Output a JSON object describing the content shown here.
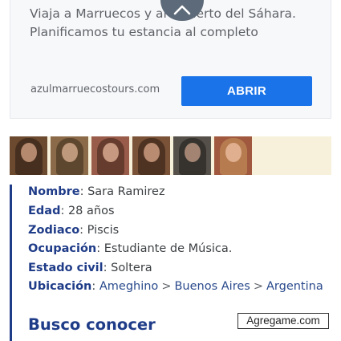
{
  "ad": {
    "line1": "Viaja a Marruecos y al desierto del Sáhara.",
    "line2": "Planificamos tu estancia al completo",
    "url": "azulmarruecostours.com",
    "button": "ABRIR"
  },
  "photos": [
    {
      "name": "photo-1",
      "color": "#6b4a2f"
    },
    {
      "name": "photo-2",
      "color": "#8a6a48"
    },
    {
      "name": "photo-3",
      "color": "#9a5c4a"
    },
    {
      "name": "photo-4",
      "color": "#7a5238"
    },
    {
      "name": "photo-5",
      "color": "#55504a"
    },
    {
      "name": "photo-6",
      "color": "#a0583e"
    }
  ],
  "profile": {
    "nombre_label": "Nombre",
    "nombre": "Sara Ramirez",
    "edad_label": "Edad",
    "edad": "28 años",
    "zodiaco_label": "Zodiaco",
    "zodiaco": "Piscis",
    "ocupacion_label": "Ocupación",
    "ocupacion": "Estudiante de Música.",
    "estado_label": "Estado civil",
    "estado": "Soltera",
    "ubicacion_label": "Ubicación",
    "ubicacion": [
      "Ameghino",
      "Buenos Aires",
      "Argentina"
    ],
    "separator": ">"
  },
  "busco": "Busco conocer",
  "brand": "Agregame.com",
  "colors": {
    "accent": "#1f3c88",
    "button": "#1a73e8"
  }
}
